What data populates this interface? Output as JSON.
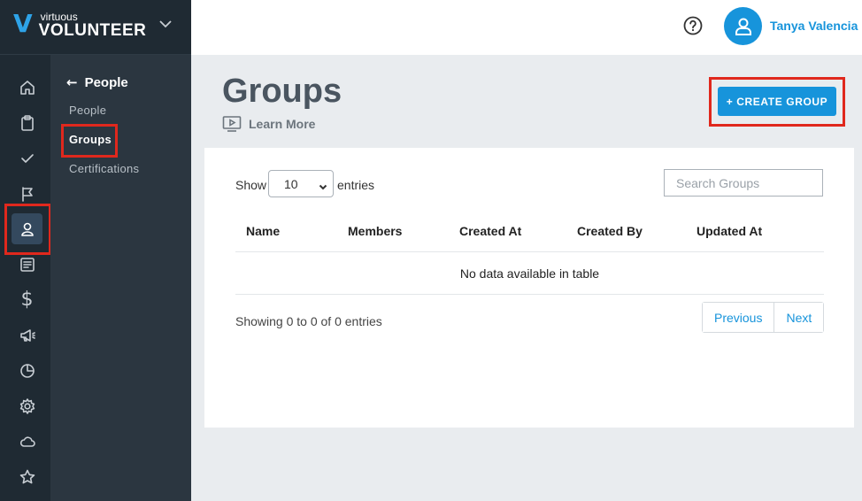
{
  "app": {
    "logo_small": "virtuous",
    "logo_big": "VOLUNTEER"
  },
  "header": {
    "user_name": "Tanya Valencia"
  },
  "rail": {
    "items": [
      {
        "name": "home-icon"
      },
      {
        "name": "clipboard-icon"
      },
      {
        "name": "check-icon"
      },
      {
        "name": "flag-icon"
      },
      {
        "name": "person-icon",
        "active": true
      },
      {
        "name": "document-icon"
      },
      {
        "name": "dollar-icon",
        "glyph": "$"
      },
      {
        "name": "megaphone-icon"
      },
      {
        "name": "pie-chart-icon"
      },
      {
        "name": "gear-icon"
      },
      {
        "name": "cloud-icon"
      },
      {
        "name": "star-icon"
      }
    ]
  },
  "subnav": {
    "title": "People",
    "back_glyph": "←",
    "items": [
      {
        "label": "People"
      },
      {
        "label": "Groups",
        "active": true
      },
      {
        "label": "Certifications"
      }
    ]
  },
  "page": {
    "title": "Groups",
    "learn_more": "Learn More",
    "create_button": "+ CREATE GROUP"
  },
  "table": {
    "show_label": "Show",
    "entries_value": "10",
    "entries_label": "entries",
    "search_placeholder": "Search Groups",
    "columns": [
      "Name",
      "Members",
      "Created At",
      "Created By",
      "Updated At"
    ],
    "empty_message": "No data available in table",
    "info": "Showing 0 to 0 of 0 entries",
    "pagination": {
      "previous": "Previous",
      "next": "Next"
    }
  },
  "colors": {
    "accent": "#1794db",
    "sidebar": "#1f2a33",
    "subnav": "#2b3640",
    "highlight": "#e0281d"
  }
}
